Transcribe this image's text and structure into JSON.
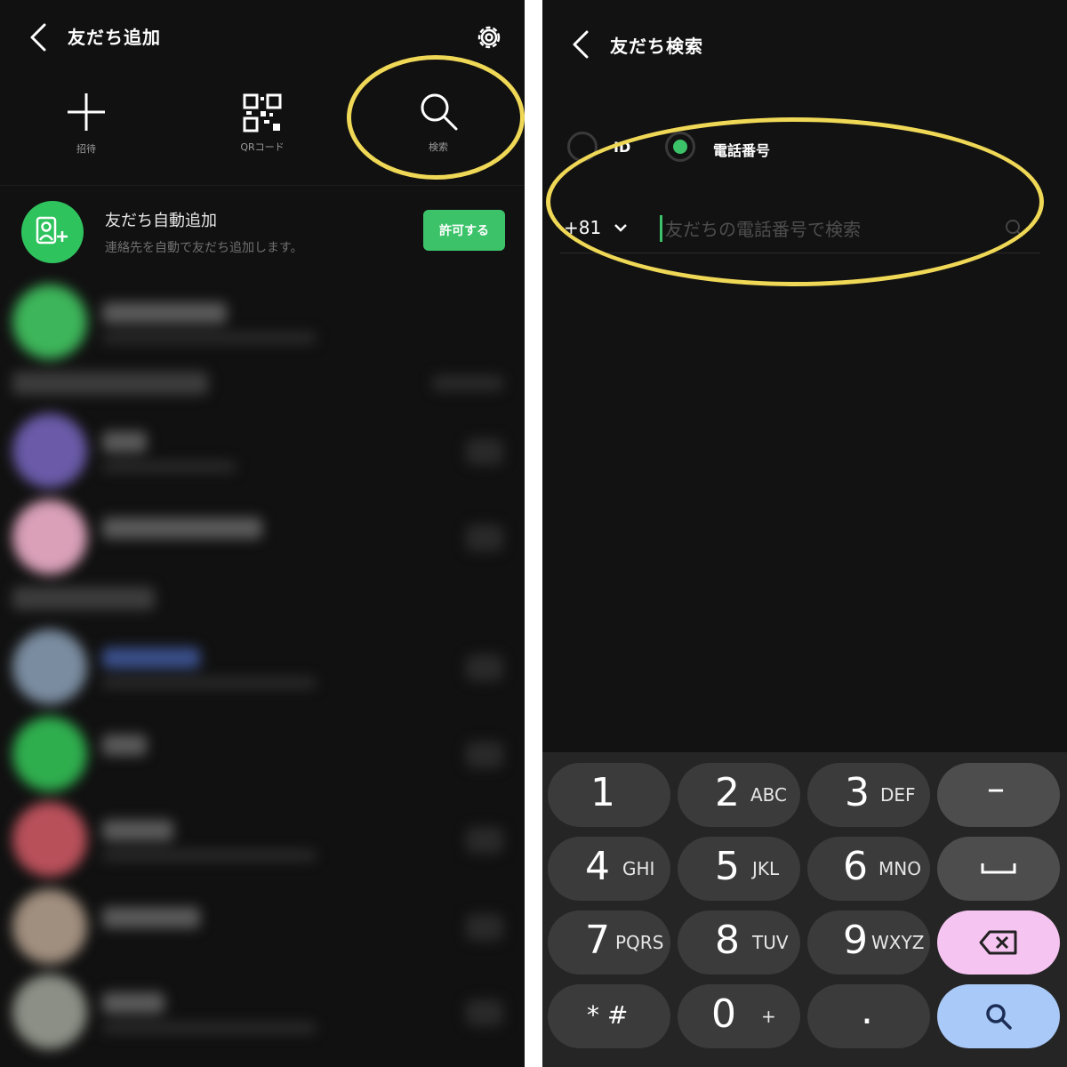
{
  "left": {
    "title": "友だち追加",
    "actions": [
      {
        "label": "招待",
        "icon": "plus-icon"
      },
      {
        "label": "QRコード",
        "icon": "qr-code-icon"
      },
      {
        "label": "検索",
        "icon": "search-icon"
      }
    ],
    "auto_add": {
      "title": "友だち自動追加",
      "subtitle": "連絡先を自動で友だち追加します。",
      "button": "許可する"
    }
  },
  "right": {
    "title": "友だち検索",
    "options": [
      {
        "label": "ID",
        "selected": false
      },
      {
        "label": "電話番号",
        "selected": true
      }
    ],
    "country_code": "+81",
    "placeholder": "友だちの電話番号で検索",
    "keys": [
      {
        "num": "1",
        "letters": ""
      },
      {
        "num": "2",
        "letters": "ABC"
      },
      {
        "num": "3",
        "letters": "DEF"
      },
      {
        "num": "4",
        "letters": "GHI"
      },
      {
        "num": "5",
        "letters": "JKL"
      },
      {
        "num": "6",
        "letters": "MNO"
      },
      {
        "num": "7",
        "letters": "PQRS"
      },
      {
        "num": "8",
        "letters": "TUV"
      },
      {
        "num": "9",
        "letters": "WXYZ"
      },
      {
        "num": "* #",
        "letters": ""
      },
      {
        "num": "0",
        "letters": "+"
      },
      {
        "num": ".",
        "letters": ""
      }
    ],
    "side_keys": [
      "–"
    ]
  },
  "colors": {
    "accent_green": "#3cc36a",
    "highlight_yellow": "#f0d857",
    "delete_key": "#f6c4f1",
    "search_key": "#a9c9f8"
  }
}
